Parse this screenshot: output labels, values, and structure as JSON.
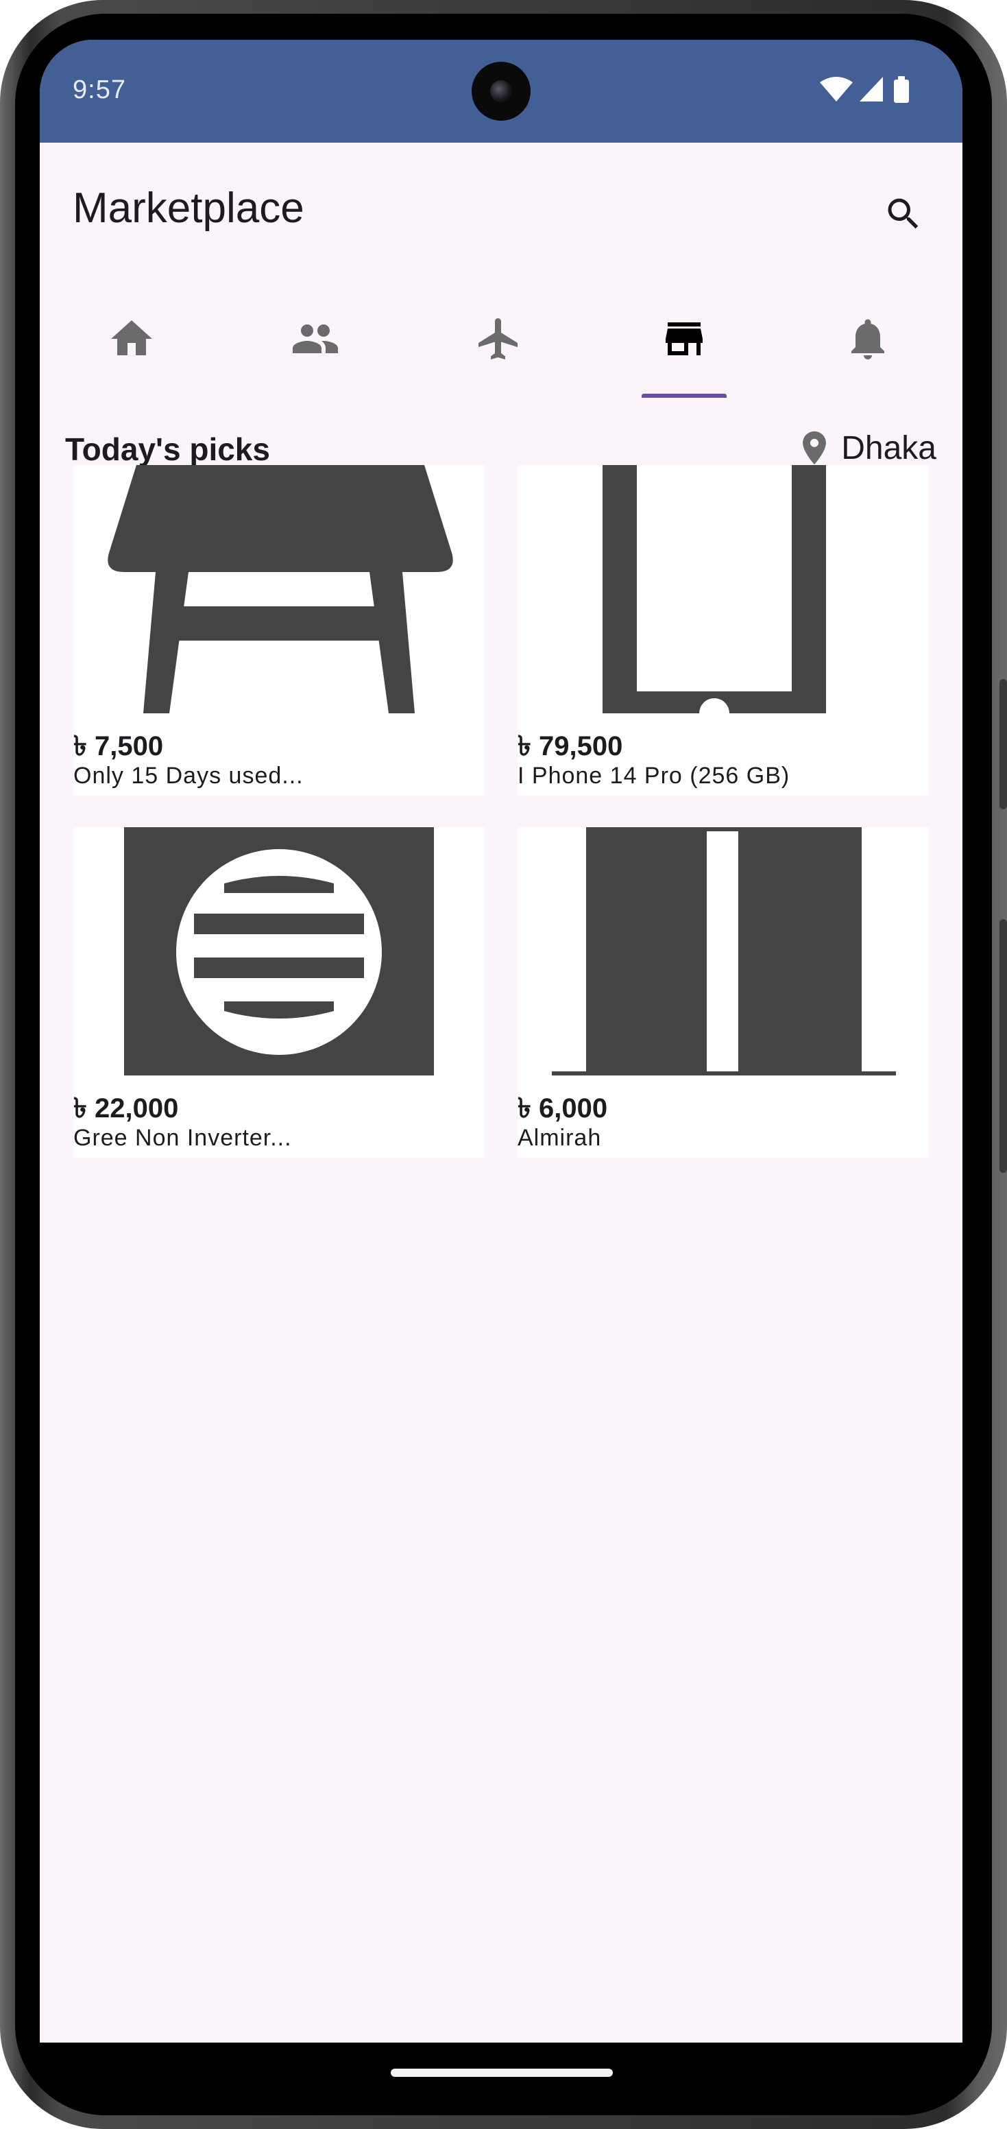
{
  "status_bar": {
    "time": "9:57",
    "background": "#425f96",
    "icons": [
      "wifi-icon",
      "cellular-signal-icon",
      "battery-icon"
    ]
  },
  "app_bar": {
    "title": "Marketplace",
    "search_icon": "search-icon"
  },
  "tabs": [
    {
      "name": "home",
      "icon": "home-icon",
      "selected": false
    },
    {
      "name": "friends",
      "icon": "people-icon",
      "selected": false
    },
    {
      "name": "travel",
      "icon": "airplane-icon",
      "selected": false
    },
    {
      "name": "marketplace",
      "icon": "storefront-icon",
      "selected": true
    },
    {
      "name": "notifications",
      "icon": "bell-icon",
      "selected": false
    }
  ],
  "accent_color": "#6750a4",
  "section": {
    "title": "Today's picks",
    "location_icon": "location-pin-icon",
    "location": "Dhaka"
  },
  "listings": [
    {
      "price": "৳ 7,500",
      "description": "Only 15 Days used...",
      "image_icon": "table-icon"
    },
    {
      "price": "৳ 79,500",
      "description": "I Phone 14 Pro (256 GB)",
      "image_icon": "smartphone-icon"
    },
    {
      "price": "৳ 22,000",
      "description": "Gree Non Inverter...",
      "image_icon": "air-conditioner-icon"
    },
    {
      "price": "৳ 6,000",
      "description": "Almirah",
      "image_icon": "wardrobe-icon"
    }
  ]
}
